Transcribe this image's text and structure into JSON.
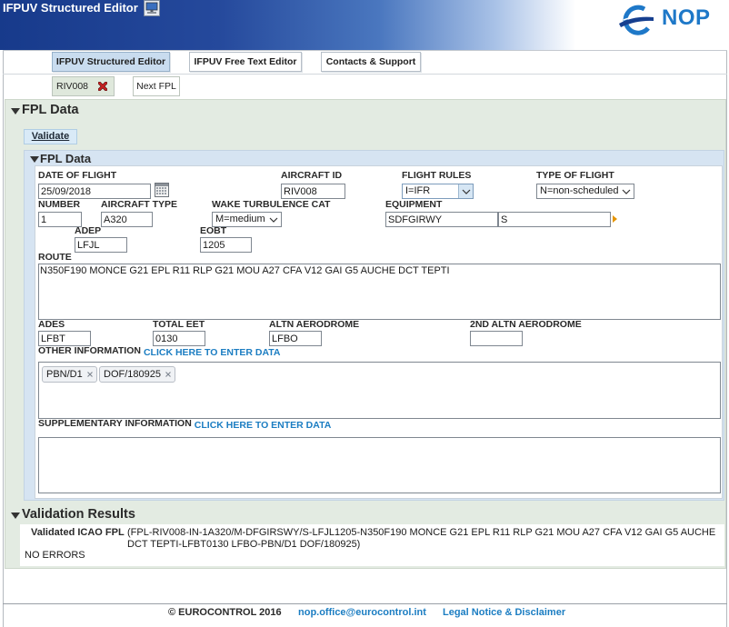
{
  "window": {
    "title": "IFPUV Structured Editor"
  },
  "brand": {
    "logo_text": "NOP"
  },
  "colors": {
    "header_navy": "#173a8b",
    "brand_blue": "#1e78c8",
    "link_blue": "#1b7dc2",
    "active_tab": "#c9dcef",
    "panel_green": "#e3ebe2",
    "subpanel_blue": "#d6e4f2",
    "close_red": "#c62020",
    "expand_orange": "#e59400"
  },
  "icons": {
    "app": "computer-icon",
    "logo": "nop-logo-icon",
    "close_tab": "close-icon",
    "collapse": "collapse-triangle-icon",
    "calendar": "calendar-icon",
    "dropdown": "chevron-down-icon",
    "expand": "expand-arrow-icon",
    "remove_tag": "remove-tag-icon"
  },
  "tabs": [
    {
      "label": "IFPUV Structured Editor",
      "active": true
    },
    {
      "label": "IFPUV Free Text Editor",
      "active": false
    },
    {
      "label": "Contacts & Support",
      "active": false
    }
  ],
  "document_tabs": [
    {
      "label": "RIV008",
      "closable": true
    },
    {
      "label": "Next FPL",
      "closable": false
    }
  ],
  "fpl": {
    "section_title": "FPL Data",
    "validate_label": "Validate",
    "panel_title": "FPL Data",
    "date_of_flight": {
      "label": "DATE OF FLIGHT",
      "value": "25/09/2018"
    },
    "aircraft_id": {
      "label": "AIRCRAFT ID",
      "value": "RIV008"
    },
    "flight_rules": {
      "label": "FLIGHT RULES",
      "value": "I=IFR"
    },
    "type_of_flight": {
      "label": "TYPE OF FLIGHT",
      "value": "N=non-scheduled"
    },
    "number": {
      "label": "NUMBER",
      "value": "1"
    },
    "aircraft_type": {
      "label": "AIRCRAFT TYPE",
      "value": "A320"
    },
    "wake_turbulence_cat": {
      "label": "WAKE TURBULENCE CAT",
      "value": "M=medium"
    },
    "equipment": {
      "label": "EQUIPMENT",
      "value": "SDFGIRWY",
      "surveillance_value": "S"
    },
    "adep": {
      "label": "ADEP",
      "value": "LFJL"
    },
    "eobt": {
      "label": "EOBT",
      "value": "1205"
    },
    "route": {
      "label": "ROUTE",
      "value": "N350F190 MONCE G21 EPL R11 RLP G21 MOU A27 CFA V12 GAI G5 AUCHE DCT TEPTI"
    },
    "ades": {
      "label": "ADES",
      "value": "LFBT"
    },
    "total_eet": {
      "label": "TOTAL EET",
      "value": "0130"
    },
    "altn_aerodrome": {
      "label": "ALTN AERODROME",
      "value": "LFBO"
    },
    "second_altn_aerodrome": {
      "label": "2ND ALTN AERODROME"
    },
    "other_information": {
      "label": "OTHER INFORMATION",
      "link": "CLICK HERE TO ENTER DATA",
      "tags": [
        "PBN/D1",
        "DOF/180925"
      ]
    },
    "supplementary_information": {
      "label": "SUPPLEMENTARY INFORMATION",
      "link": "CLICK HERE TO ENTER DATA"
    }
  },
  "validation": {
    "title": "Validation Results",
    "label": "Validated ICAO FPL",
    "text": "(FPL-RIV008-IN-1A320/M-DFGIRSWY/S-LFJL1205-N350F190 MONCE G21 EPL R11 RLP G21 MOU A27 CFA V12 GAI G5 AUCHE DCT TEPTI-LFBT0130 LFBO-PBN/D1 DOF/180925)",
    "status": "NO ERRORS"
  },
  "footer": {
    "copyright": "© EUROCONTROL 2016",
    "email": "nop.office@eurocontrol.int",
    "legal": "Legal Notice & Disclaimer"
  }
}
